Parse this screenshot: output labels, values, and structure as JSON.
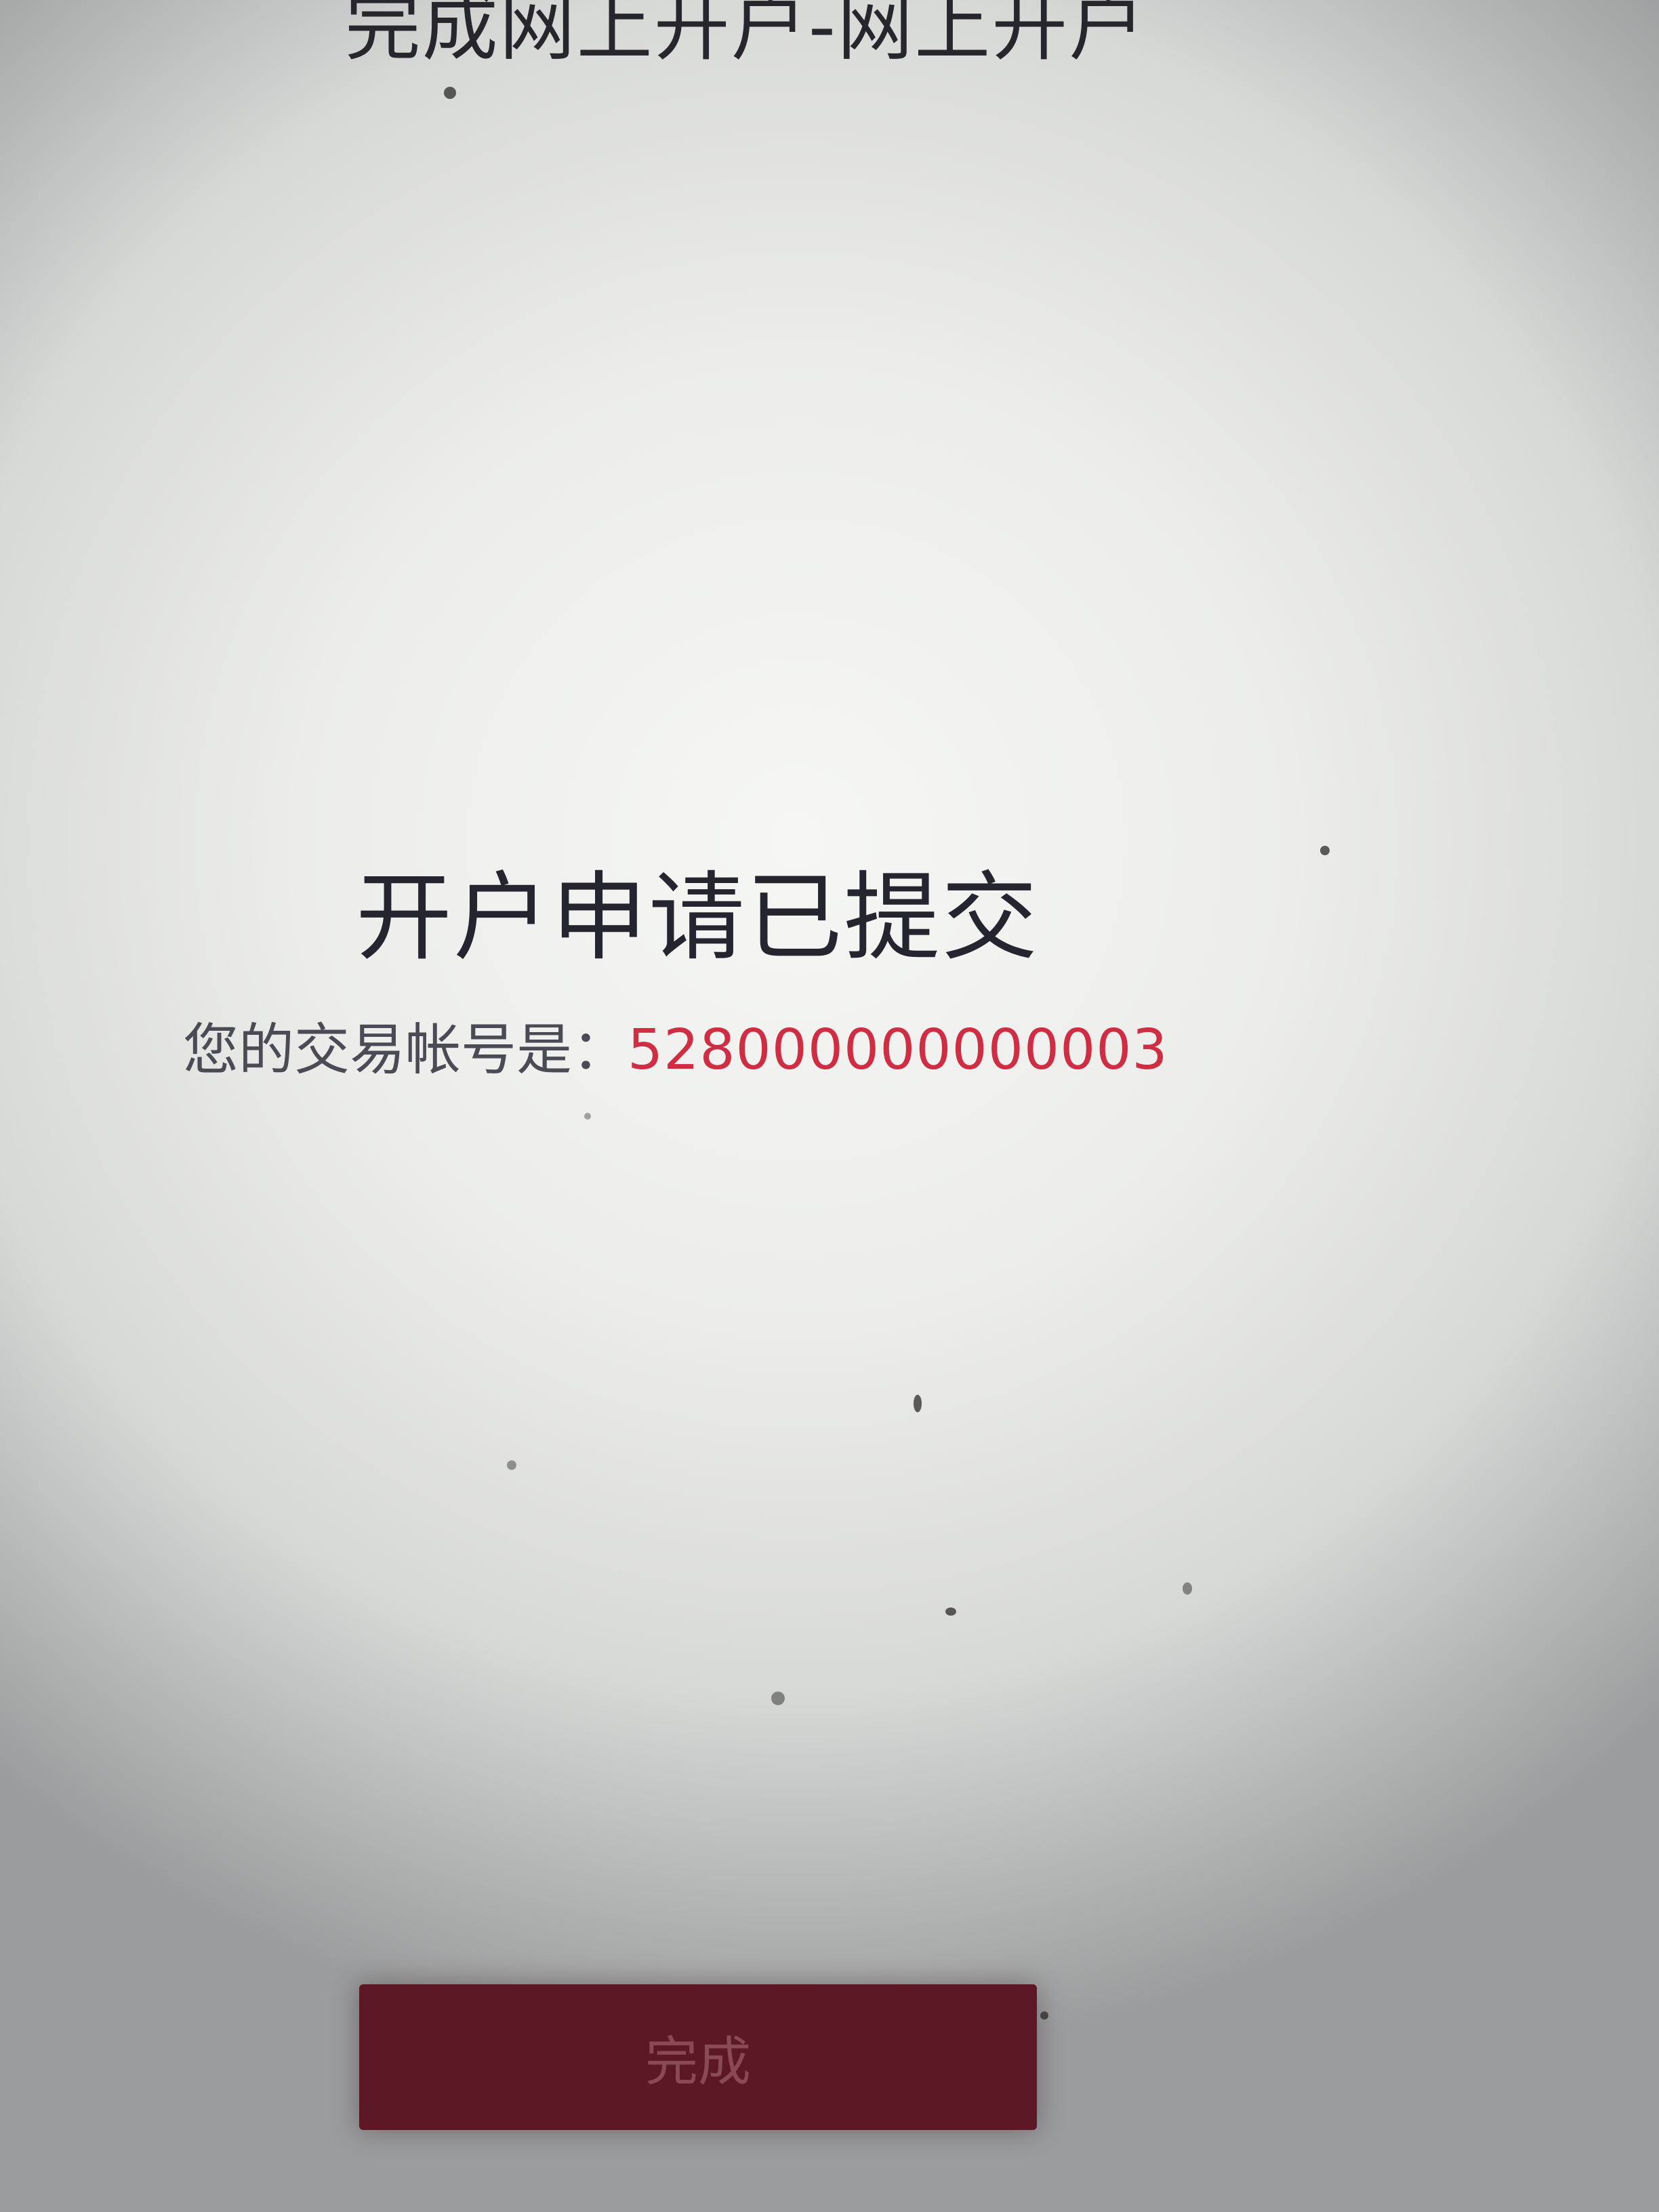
{
  "header": {
    "title": "完成网上开户-网上开户"
  },
  "result": {
    "heading": "开户申请已提交",
    "account_label": "您的交易帐号是：",
    "account_number": "528000000000003"
  },
  "actions": {
    "done_label": "完成"
  },
  "colors": {
    "accent_red": "#cf2d43",
    "button_bg": "#5c1824",
    "text_dark": "#24252e"
  }
}
